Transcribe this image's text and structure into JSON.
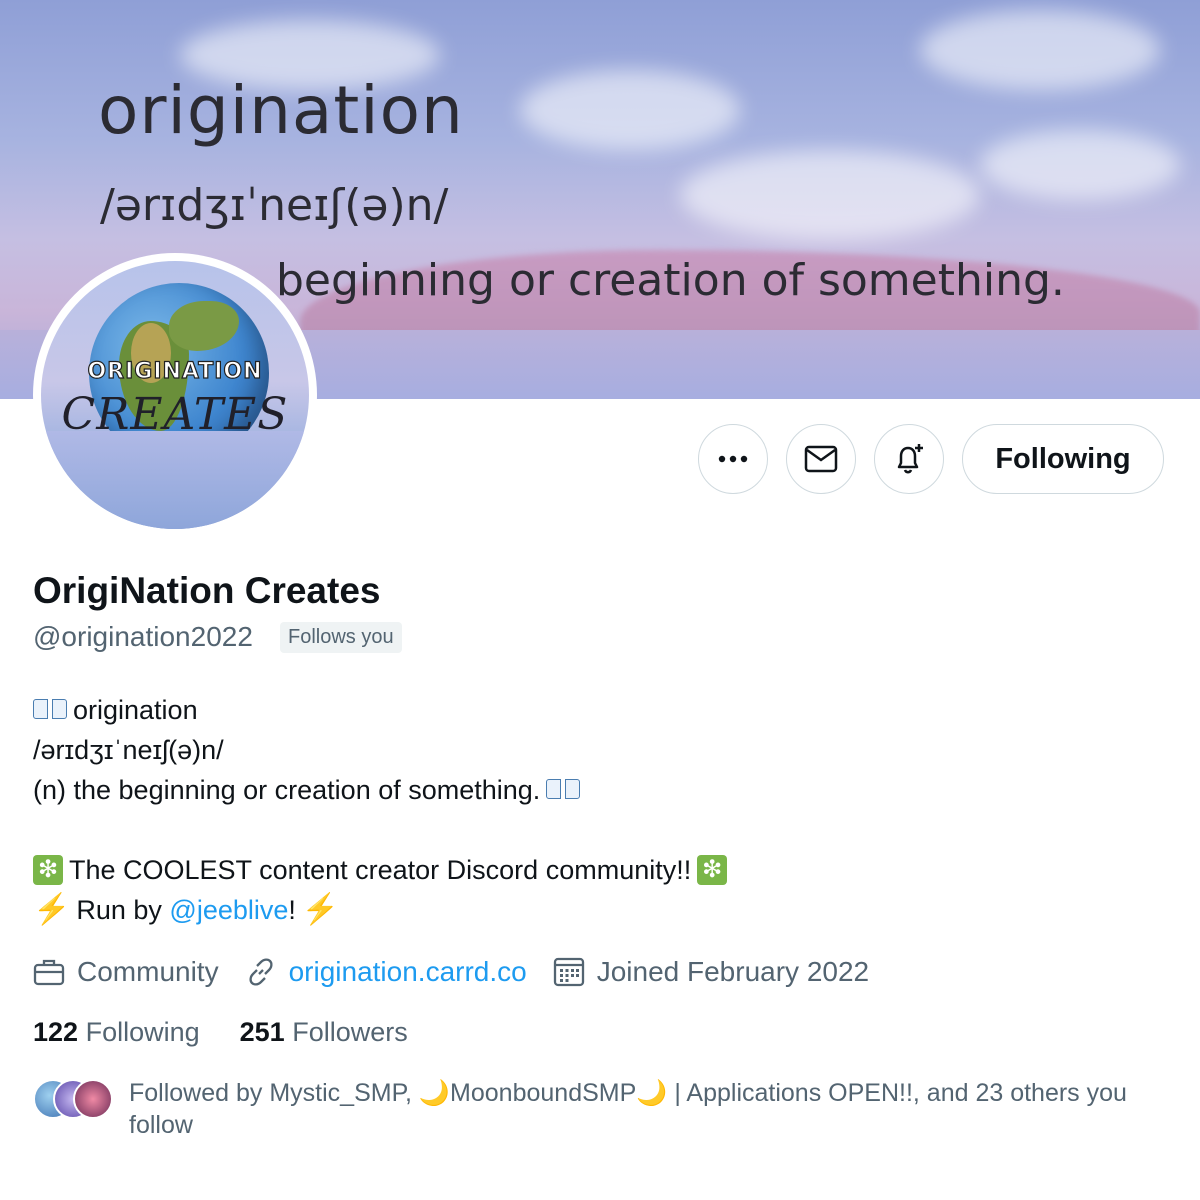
{
  "banner": {
    "word": "origination",
    "phonetic": "/ərɪdʒɪˈneɪʃ(ə)n/",
    "definition_visible": "beginning or creation of something."
  },
  "avatar": {
    "title": "ORIGINATION",
    "subtitle": "CREATES"
  },
  "actions": {
    "more_icon": "more-icon",
    "message_icon": "mail-icon",
    "notify_icon": "bell-plus-icon",
    "follow_label": "Following"
  },
  "profile": {
    "display_name": "OrigiNation Creates",
    "handle": "@origination2022",
    "follows_you": "Follows you"
  },
  "bio": {
    "line1": "origination",
    "line2": "/ərɪdʒɪˈneɪʃ(ə)n/",
    "line3": "(n) the beginning or creation of something.",
    "line4": "The COOLEST content creator Discord community!!",
    "line5_prefix": "Run by ",
    "line5_mention": "@jeeblive",
    "line5_suffix": "!",
    "emoji_spark": "❇",
    "emoji_bolt": "⚡"
  },
  "meta": {
    "category": "Community",
    "link": "origination.carrd.co",
    "joined": "Joined February 2022"
  },
  "stats": {
    "following_count": "122",
    "following_label": "Following",
    "followers_count": "251",
    "followers_label": "Followers"
  },
  "followed_by": {
    "text": "Followed by Mystic_SMP, 🌙MoonboundSMP🌙 | Applications OPEN!!, and 23 others you follow"
  },
  "colors": {
    "link": "#1d9bf0",
    "secondary_text": "#536471",
    "primary_text": "#0f1419"
  }
}
